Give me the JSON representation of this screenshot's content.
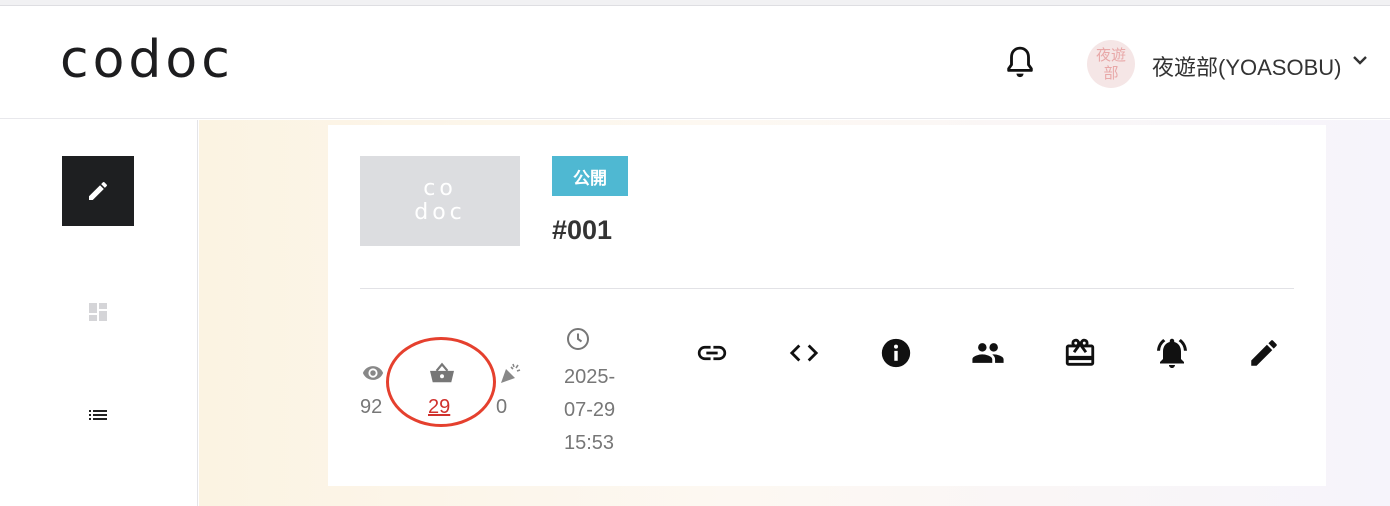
{
  "header": {
    "logo": "codoc",
    "user": {
      "name": "夜遊部(YOASOBU)",
      "avatar_line1": "夜遊",
      "avatar_line2": "部"
    },
    "icons": {
      "notifications": "bell-icon",
      "menu": "chevron-down-icon"
    }
  },
  "sidebar": {
    "items": [
      {
        "icon": "pencil-icon",
        "active": true
      },
      {
        "icon": "dashboard-icon",
        "active": false
      },
      {
        "icon": "list-icon",
        "active": false
      }
    ]
  },
  "article": {
    "thumbnail_line1": "co",
    "thumbnail_line2": "doc",
    "status": "公開",
    "title": "#001",
    "stats": {
      "views": "92",
      "sales": "29",
      "support": "0"
    },
    "date_line1": "2025-",
    "date_line2": "07-29",
    "date_line3": "15:53",
    "actions": [
      "link-icon",
      "embed-code-icon",
      "info-icon",
      "members-icon",
      "gift-card-icon",
      "notification-alert-icon",
      "edit-icon"
    ]
  },
  "colors": {
    "accent_badge": "#4fb8d2",
    "highlight": "#e5402e",
    "sales_link": "#d0312d",
    "sidebar_active": "#1e1f21"
  }
}
